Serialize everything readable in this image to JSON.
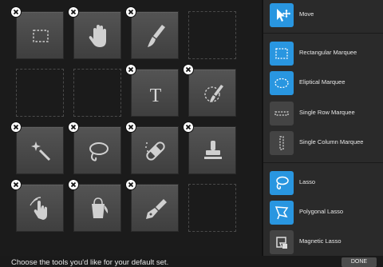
{
  "grid": {
    "cells": [
      {
        "icon": "rectangular-marquee-icon",
        "removable": true
      },
      {
        "icon": "hand-icon",
        "removable": true
      },
      {
        "icon": "brush-icon",
        "removable": true
      },
      {
        "icon": null,
        "removable": false
      },
      {
        "icon": null,
        "removable": false
      },
      {
        "icon": null,
        "removable": false
      },
      {
        "icon": "type-icon",
        "removable": true
      },
      {
        "icon": "quick-selection-icon",
        "removable": true
      },
      {
        "icon": "magic-wand-icon",
        "removable": true
      },
      {
        "icon": "lasso-icon",
        "removable": true
      },
      {
        "icon": "healing-bandage-icon",
        "removable": true
      },
      {
        "icon": "stamp-icon",
        "removable": true
      },
      {
        "icon": "smudge-hand-icon",
        "removable": true
      },
      {
        "icon": "paint-bucket-icon",
        "removable": true
      },
      {
        "icon": "pen-icon",
        "removable": true
      },
      {
        "icon": null,
        "removable": false
      }
    ]
  },
  "tool_list": [
    {
      "label": "Move",
      "icon": "move-icon",
      "active": true
    },
    {
      "label": "Rectangular Marquee",
      "icon": "rectangular-marquee-icon",
      "active": true
    },
    {
      "label": "Eliptical Marquee",
      "icon": "elliptical-marquee-icon",
      "active": true
    },
    {
      "label": "Single Row Marquee",
      "icon": "single-row-marquee-icon",
      "active": false
    },
    {
      "label": "Single Column Marquee",
      "icon": "single-column-marquee-icon",
      "active": false
    },
    {
      "label": "Lasso",
      "icon": "lasso-icon",
      "active": true
    },
    {
      "label": "Polygonal Lasso",
      "icon": "polygonal-lasso-icon",
      "active": true
    },
    {
      "label": "Magnetic Lasso",
      "icon": "magnetic-lasso-icon",
      "active": false
    }
  ],
  "footer": {
    "instruction": "Choose the tools you'd like for your default set.",
    "done_label": "DONE"
  },
  "colors": {
    "accent": "#2996e0",
    "panel": "#2a2a2a",
    "tile": "#4a4a4a"
  }
}
